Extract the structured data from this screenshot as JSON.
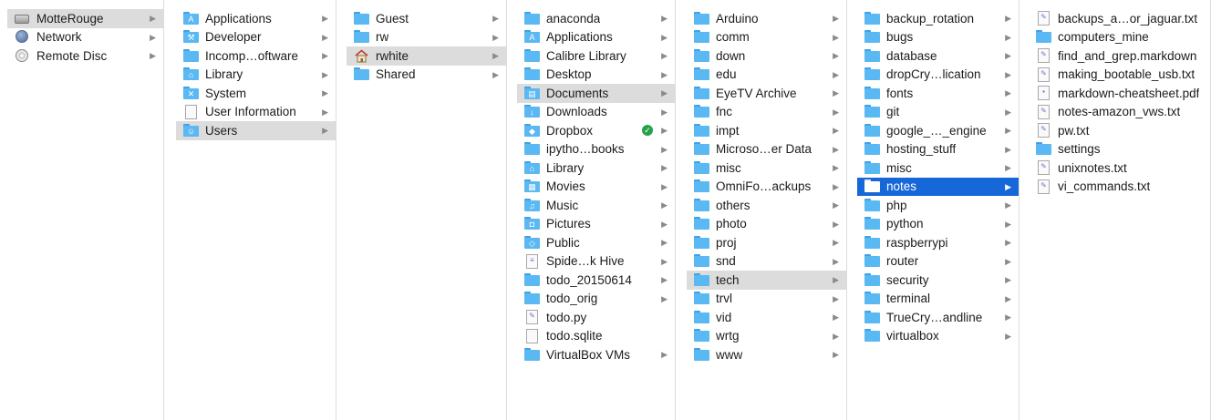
{
  "colors": {
    "folder": "#5ab8f2",
    "selection_blue": "#1668d8",
    "selection_gray": "#dcdcdc",
    "sync_green": "#26a34a"
  },
  "columns": [
    {
      "id": "devices",
      "items": [
        {
          "label": "MotteRouge",
          "icon": "hard-drive-icon",
          "arrow": true,
          "selected": "gray"
        },
        {
          "label": "Network",
          "icon": "network-globe-icon",
          "arrow": true
        },
        {
          "label": "Remote Disc",
          "icon": "remote-disc-icon",
          "arrow": true
        }
      ]
    },
    {
      "id": "root",
      "items": [
        {
          "label": "Applications",
          "icon": "applications-folder-icon",
          "arrow": true
        },
        {
          "label": "Developer",
          "icon": "developer-folder-icon",
          "arrow": true
        },
        {
          "label": "Incomp…oftware",
          "icon": "folder-icon",
          "arrow": true
        },
        {
          "label": "Library",
          "icon": "library-folder-icon",
          "arrow": true
        },
        {
          "label": "System",
          "icon": "system-folder-icon",
          "arrow": true
        },
        {
          "label": "User Information",
          "icon": "user-info-file-icon",
          "arrow": true
        },
        {
          "label": "Users",
          "icon": "users-folder-icon",
          "arrow": true,
          "selected": "gray"
        }
      ]
    },
    {
      "id": "users",
      "items": [
        {
          "label": "Guest",
          "icon": "folder-icon",
          "arrow": true
        },
        {
          "label": "rw",
          "icon": "folder-icon",
          "arrow": true
        },
        {
          "label": "rwhite",
          "icon": "home-icon",
          "arrow": true,
          "selected": "gray"
        },
        {
          "label": "Shared",
          "icon": "folder-icon",
          "arrow": true
        }
      ]
    },
    {
      "id": "rwhite",
      "items": [
        {
          "label": "anaconda",
          "icon": "folder-icon",
          "arrow": true
        },
        {
          "label": "Applications",
          "icon": "applications-folder-icon",
          "arrow": true
        },
        {
          "label": "Calibre Library",
          "icon": "folder-icon",
          "arrow": true
        },
        {
          "label": "Desktop",
          "icon": "folder-icon",
          "arrow": true
        },
        {
          "label": "Documents",
          "icon": "documents-folder-icon",
          "arrow": true,
          "selected": "gray"
        },
        {
          "label": "Downloads",
          "icon": "downloads-folder-icon",
          "arrow": true
        },
        {
          "label": "Dropbox",
          "icon": "dropbox-folder-icon",
          "arrow": true,
          "badge": "sync-check-icon"
        },
        {
          "label": "ipytho…books",
          "icon": "folder-icon",
          "arrow": true
        },
        {
          "label": "Library",
          "icon": "library-folder-icon",
          "arrow": true
        },
        {
          "label": "Movies",
          "icon": "movies-folder-icon",
          "arrow": true
        },
        {
          "label": "Music",
          "icon": "music-folder-icon",
          "arrow": true
        },
        {
          "label": "Pictures",
          "icon": "pictures-folder-icon",
          "arrow": true
        },
        {
          "label": "Public",
          "icon": "public-folder-icon",
          "arrow": true
        },
        {
          "label": "Spide…k Hive",
          "icon": "hive-file-icon",
          "arrow": true
        },
        {
          "label": "todo_20150614",
          "icon": "folder-icon",
          "arrow": true
        },
        {
          "label": "todo_orig",
          "icon": "folder-icon",
          "arrow": true
        },
        {
          "label": "todo.py",
          "icon": "python-file-icon",
          "arrow": false
        },
        {
          "label": "todo.sqlite",
          "icon": "document-file-icon",
          "arrow": false
        },
        {
          "label": "VirtualBox VMs",
          "icon": "folder-icon",
          "arrow": true
        }
      ]
    },
    {
      "id": "documents",
      "items": [
        {
          "label": "Arduino",
          "icon": "folder-icon",
          "arrow": true
        },
        {
          "label": "comm",
          "icon": "folder-icon",
          "arrow": true
        },
        {
          "label": "down",
          "icon": "folder-icon",
          "arrow": true
        },
        {
          "label": "edu",
          "icon": "folder-icon",
          "arrow": true
        },
        {
          "label": "EyeTV Archive",
          "icon": "folder-icon",
          "arrow": true
        },
        {
          "label": "fnc",
          "icon": "folder-icon",
          "arrow": true
        },
        {
          "label": "impt",
          "icon": "folder-icon",
          "arrow": true
        },
        {
          "label": "Microso…er Data",
          "icon": "folder-icon",
          "arrow": true
        },
        {
          "label": "misc",
          "icon": "folder-icon",
          "arrow": true
        },
        {
          "label": "OmniFo…ackups",
          "icon": "folder-icon",
          "arrow": true
        },
        {
          "label": "others",
          "icon": "folder-icon",
          "arrow": true
        },
        {
          "label": "photo",
          "icon": "folder-icon",
          "arrow": true
        },
        {
          "label": "proj",
          "icon": "folder-icon",
          "arrow": true
        },
        {
          "label": "snd",
          "icon": "folder-icon",
          "arrow": true
        },
        {
          "label": "tech",
          "icon": "folder-icon",
          "arrow": true,
          "selected": "gray"
        },
        {
          "label": "trvl",
          "icon": "folder-icon",
          "arrow": true
        },
        {
          "label": "vid",
          "icon": "folder-icon",
          "arrow": true
        },
        {
          "label": "wrtg",
          "icon": "folder-icon",
          "arrow": true
        },
        {
          "label": "www",
          "icon": "folder-icon",
          "arrow": true
        }
      ]
    },
    {
      "id": "tech",
      "items": [
        {
          "label": "backup_rotation",
          "icon": "folder-icon",
          "arrow": true
        },
        {
          "label": "bugs",
          "icon": "folder-icon",
          "arrow": true
        },
        {
          "label": "database",
          "icon": "folder-icon",
          "arrow": true
        },
        {
          "label": "dropCry…lication",
          "icon": "folder-icon",
          "arrow": true
        },
        {
          "label": "fonts",
          "icon": "folder-icon",
          "arrow": true
        },
        {
          "label": "git",
          "icon": "folder-icon",
          "arrow": true
        },
        {
          "label": "google_…_engine",
          "icon": "folder-icon",
          "arrow": true
        },
        {
          "label": "hosting_stuff",
          "icon": "folder-icon",
          "arrow": true
        },
        {
          "label": "misc",
          "icon": "folder-icon",
          "arrow": true
        },
        {
          "label": "notes",
          "icon": "folder-icon",
          "arrow": true,
          "selected": "blue"
        },
        {
          "label": "php",
          "icon": "folder-icon",
          "arrow": true
        },
        {
          "label": "python",
          "icon": "folder-icon",
          "arrow": true
        },
        {
          "label": "raspberrypi",
          "icon": "folder-icon",
          "arrow": true
        },
        {
          "label": "router",
          "icon": "folder-icon",
          "arrow": true
        },
        {
          "label": "security",
          "icon": "folder-icon",
          "arrow": true
        },
        {
          "label": "terminal",
          "icon": "folder-icon",
          "arrow": true
        },
        {
          "label": "TrueCry…andline",
          "icon": "folder-icon",
          "arrow": true
        },
        {
          "label": "virtualbox",
          "icon": "folder-icon",
          "arrow": true
        }
      ]
    },
    {
      "id": "notes",
      "items": [
        {
          "label": "backups_a…or_jaguar.txt",
          "icon": "text-file-icon",
          "arrow": false
        },
        {
          "label": "computers_mine",
          "icon": "folder-icon",
          "arrow": false
        },
        {
          "label": "find_and_grep.markdown",
          "icon": "text-file-icon",
          "arrow": false
        },
        {
          "label": "making_bootable_usb.txt",
          "icon": "text-file-icon",
          "arrow": false
        },
        {
          "label": "markdown-cheatsheet.pdf",
          "icon": "pdf-file-icon",
          "arrow": false
        },
        {
          "label": "notes-amazon_vws.txt",
          "icon": "text-file-icon",
          "arrow": false
        },
        {
          "label": "pw.txt",
          "icon": "text-file-icon",
          "arrow": false
        },
        {
          "label": "settings",
          "icon": "folder-icon",
          "arrow": false
        },
        {
          "label": "unixnotes.txt",
          "icon": "text-file-icon",
          "arrow": false
        },
        {
          "label": "vi_commands.txt",
          "icon": "text-file-icon",
          "arrow": false
        }
      ]
    }
  ]
}
